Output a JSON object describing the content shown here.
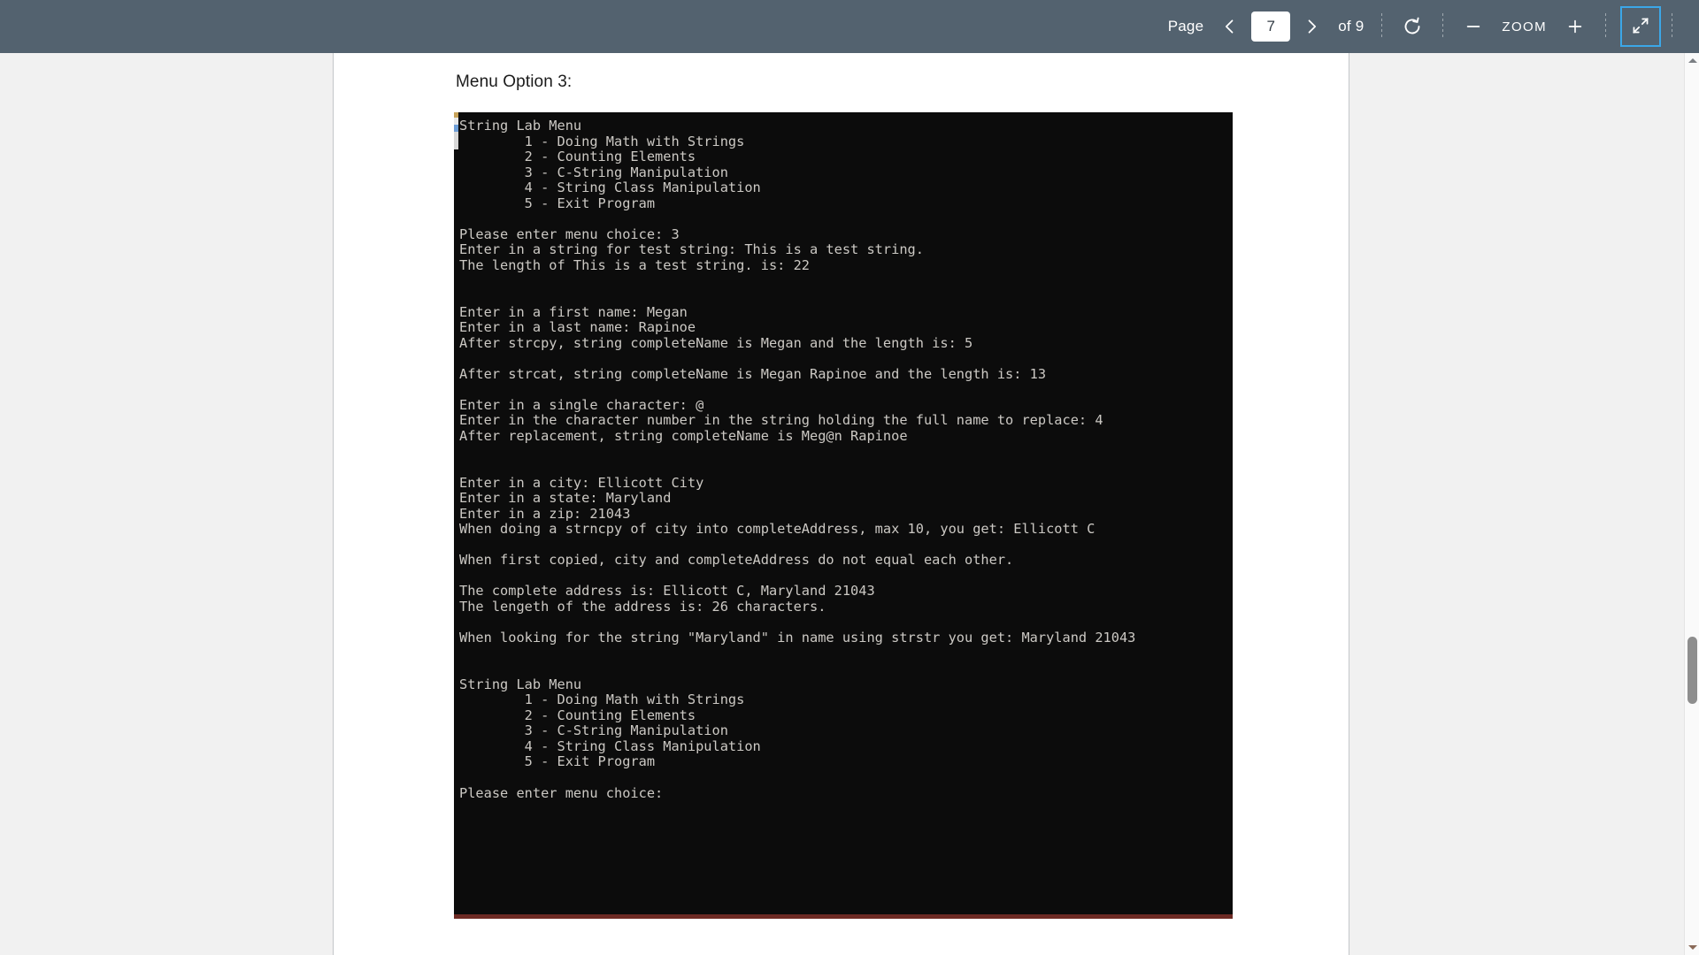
{
  "toolbar": {
    "page_label": "Page",
    "prev_page_icon": "chevron-left-icon",
    "page_value": "7",
    "next_page_icon": "chevron-right-icon",
    "page_total_label": "of 9",
    "rotate_icon": "rotate-clockwise-icon",
    "zoom_out_label": "—",
    "zoom_label": "ZOOM",
    "zoom_in_label": "+",
    "fullscreen_exit_icon": "compress-arrows-icon",
    "background_color": "#53626f",
    "accent_color": "#3ba7e8"
  },
  "document": {
    "heading": "Menu Option 3:",
    "console": {
      "background_color": "#0c0c0c",
      "text_color": "#ccc9c4",
      "lines": [
        "String Lab Menu",
        "        1 - Doing Math with Strings",
        "        2 - Counting Elements",
        "        3 - C-String Manipulation",
        "        4 - String Class Manipulation",
        "        5 - Exit Program",
        "",
        "Please enter menu choice: 3",
        "Enter in a string for test string: This is a test string.",
        "The length of This is a test string. is: 22",
        "",
        "",
        "Enter in a first name: Megan",
        "Enter in a last name: Rapinoe",
        "After strcpy, string completeName is Megan and the length is: 5",
        "",
        "After strcat, string completeName is Megan Rapinoe and the length is: 13",
        "",
        "Enter in a single character: @",
        "Enter in the character number in the string holding the full name to replace: 4",
        "After replacement, string completeName is Meg@n Rapinoe",
        "",
        "",
        "Enter in a city: Ellicott City",
        "Enter in a state: Maryland",
        "Enter in a zip: 21043",
        "When doing a strncpy of city into completeAddress, max 10, you get: Ellicott C",
        "",
        "When first copied, city and completeAddress do not equal each other.",
        "",
        "The complete address is: Ellicott C, Maryland 21043",
        "The lengeth of the address is: 26 characters.",
        "",
        "When looking for the string \"Maryland\" in name using strstr you get: Maryland 21043",
        "",
        "",
        "String Lab Menu",
        "        1 - Doing Math with Strings",
        "        2 - Counting Elements",
        "        3 - C-String Manipulation",
        "        4 - String Class Manipulation",
        "        5 - Exit Program",
        "",
        "Please enter menu choice:"
      ]
    }
  },
  "scrollbar": {
    "up_arrow_icon": "triangle-up-icon",
    "down_arrow_icon": "triangle-down-icon",
    "thumb_name": "scroll-thumb"
  }
}
